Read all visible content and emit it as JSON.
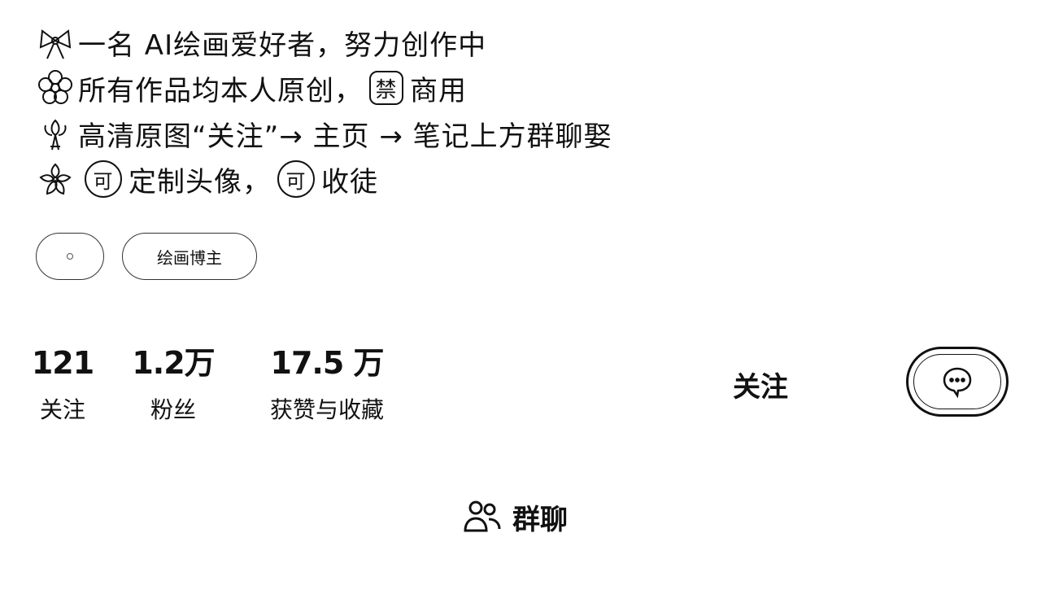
{
  "bio": {
    "line1": {
      "icon": "bow-icon",
      "text": "一名 AI绘画爱好者，努力创作中"
    },
    "line2": {
      "icon": "flower-icon",
      "text": "所有作品均本人原创，",
      "boxed": "禁",
      "suffix": "商用"
    },
    "line3": {
      "icon": "bouquet-icon",
      "text": "高清原图“关注”→ 主页 → 笔记上方群聊娶"
    },
    "line4": {
      "icon": "blossom-icon",
      "circled1": "可",
      "text1": "定制头像，",
      "circled2": "可",
      "text2": "收徒"
    }
  },
  "tags": {
    "gender_icon": "gender-icon",
    "topic": "绘画博主"
  },
  "stats": [
    {
      "value": "121",
      "label": "关注"
    },
    {
      "value": "1.2万",
      "label": "粉丝"
    },
    {
      "value": "17.5 万",
      "label": "获赞与收藏"
    }
  ],
  "actions": {
    "follow_label": "关注",
    "message_icon": "chat-bubble-icon",
    "group_chat_icon": "people-icon",
    "group_chat_label": "群聊"
  }
}
